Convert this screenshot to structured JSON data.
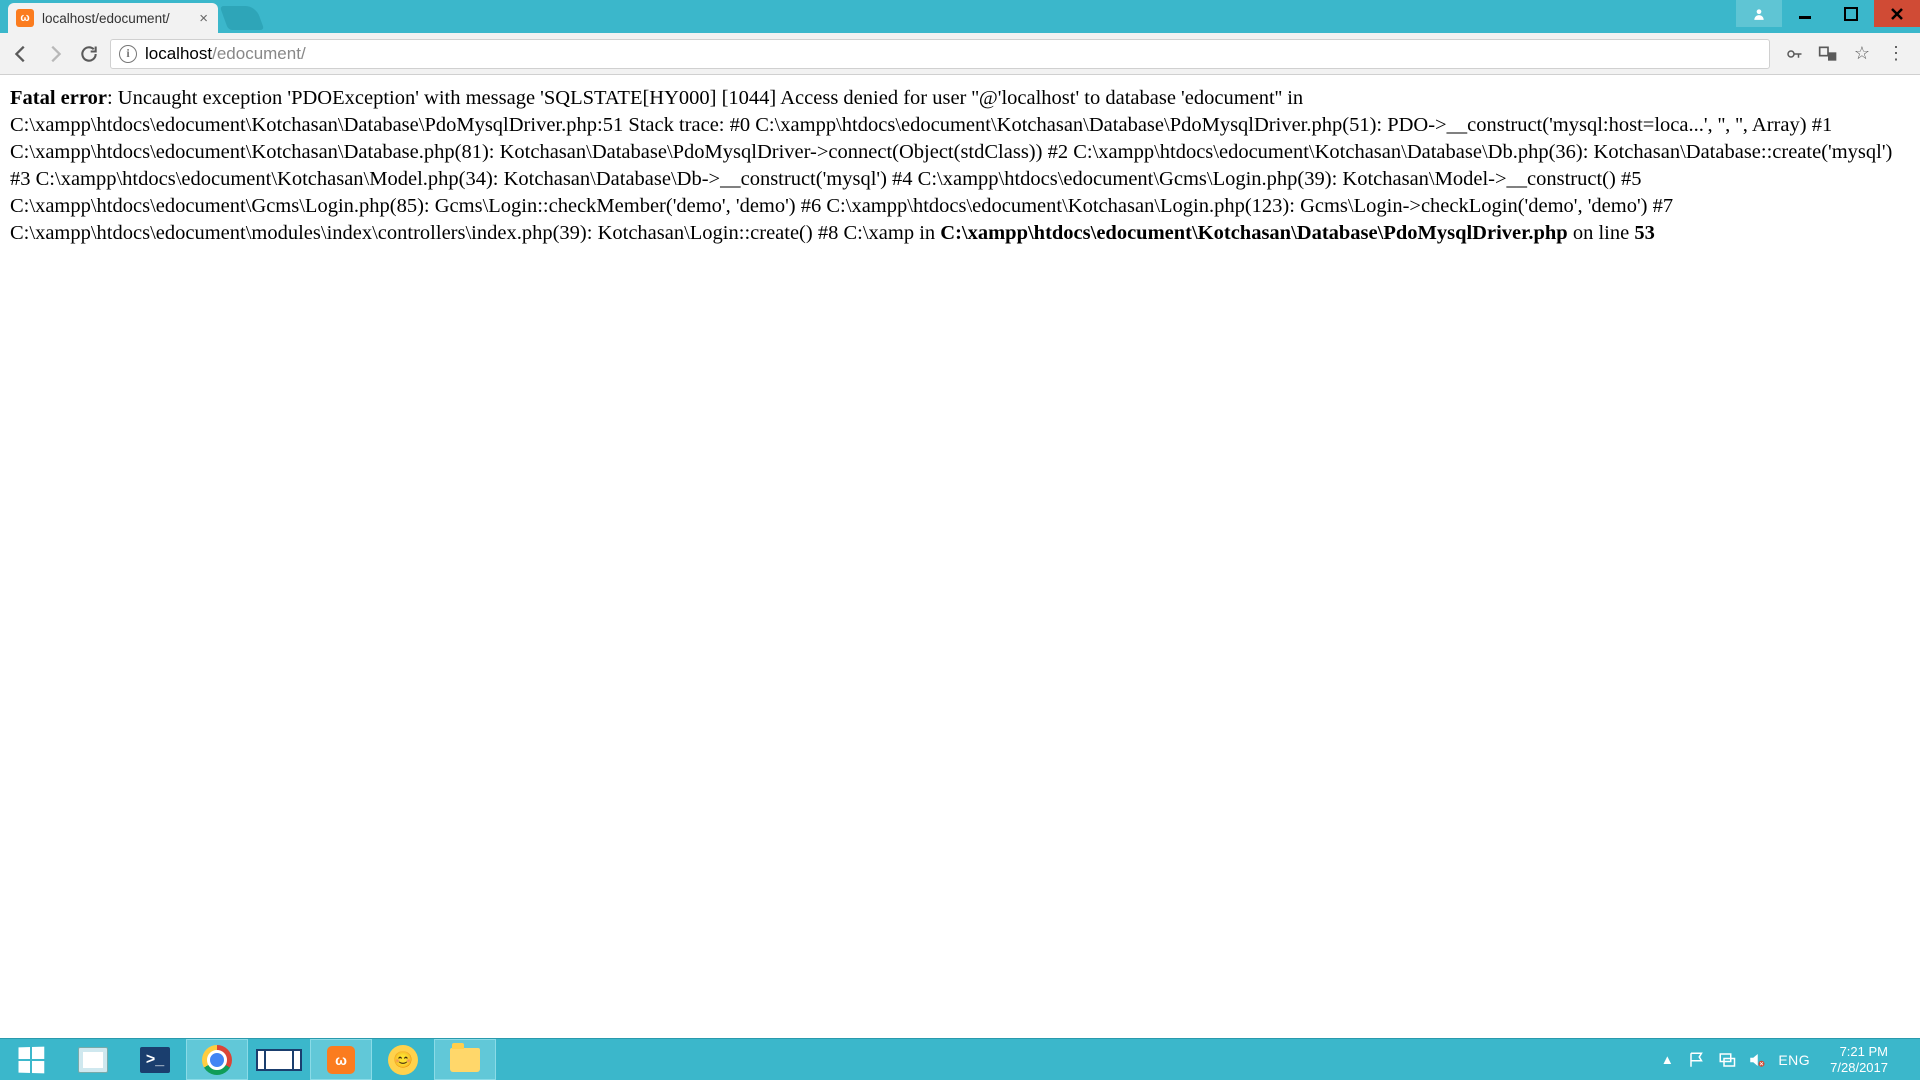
{
  "window": {
    "tab_title": "localhost/edocument/",
    "user_badge": "",
    "controls": {
      "minimize": "–",
      "maximize": "□",
      "close": "✕"
    }
  },
  "toolbar": {
    "url_host": "localhost",
    "url_path": "/edocument/",
    "info_tooltip": "View site information"
  },
  "error": {
    "label": "Fatal error",
    "body_prefix": ": Uncaught exception 'PDOException' with message 'SQLSTATE[HY000] [1044] Access denied for user ''@'localhost' to database 'edocument'' in C:\\xampp\\htdocs\\edocument\\Kotchasan\\Database\\PdoMysqlDriver.php:51 Stack trace: #0 C:\\xampp\\htdocs\\edocument\\Kotchasan\\Database\\PdoMysqlDriver.php(51): PDO->__construct('mysql:host=loca...', '', '', Array) #1 C:\\xampp\\htdocs\\edocument\\Kotchasan\\Database.php(81): Kotchasan\\Database\\PdoMysqlDriver->connect(Object(stdClass)) #2 C:\\xampp\\htdocs\\edocument\\Kotchasan\\Database\\Db.php(36): Kotchasan\\Database::create('mysql') #3 C:\\xampp\\htdocs\\edocument\\Kotchasan\\Model.php(34): Kotchasan\\Database\\Db->__construct('mysql') #4 C:\\xampp\\htdocs\\edocument\\Gcms\\Login.php(39): Kotchasan\\Model->__construct() #5 C:\\xampp\\htdocs\\edocument\\Gcms\\Login.php(85): Gcms\\Login::checkMember('demo', 'demo') #6 C:\\xampp\\htdocs\\edocument\\Kotchasan\\Login.php(123): Gcms\\Login->checkLogin('demo', 'demo') #7 C:\\xampp\\htdocs\\edocument\\modules\\index\\controllers\\index.php(39): Kotchasan\\Login::create() #8 C:\\xamp in ",
    "file": "C:\\xampp\\htdocs\\edocument\\Kotchasan\\Database\\PdoMysqlDriver.php",
    "on_line_text": " on line ",
    "line": "53"
  },
  "taskbar": {
    "lang": "ENG",
    "time": "7:21 PM",
    "date": "7/28/2017",
    "tray_arrow": "▲"
  }
}
